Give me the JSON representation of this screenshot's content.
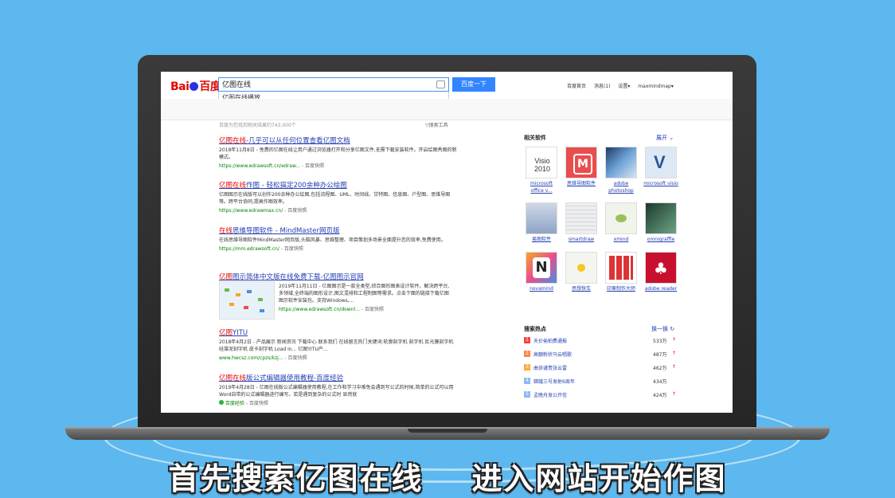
{
  "baidu": {
    "logo": "Bai百度",
    "search_query": "亿图在线",
    "search_button": "百度一下",
    "suggestion": "亿图在线播放",
    "suggest_feedback": "反馈",
    "user_links": [
      "百度首页",
      "消息(1)",
      "设置▾",
      "maxmindmap▾"
    ],
    "result_count": "百度为您找到相关结果约743,000个",
    "search_tools": "搜索工具"
  },
  "results": [
    {
      "title_pre": "",
      "title_em": "亿图在线",
      "title_post": "-几乎可以从任何位置查看亿图文档",
      "desc": "2018年11月8日 - 免费的亿图在线让用户通过浏览器打开和分享亿图文件,无需下载安装软件。开启绘图秀图的新模式。",
      "url": "https://www.edrawsoft.cn/edraw...",
      "cache": "- 百度快照"
    },
    {
      "title_pre": "",
      "title_em": "亿图在线",
      "title_post": "作图 - 轻松搞定200余种办公绘图",
      "desc": "亿图图示在线版可以创作200余种办公绘图,包括流程图、UML、时间线、甘特图、信息图、户型图、思维导图等。跨平台协同,提高作图效率。",
      "url": "https://www.edrawmax.cn/",
      "cache": "- 百度快照"
    },
    {
      "title_pre": "",
      "title_em": "在线",
      "title_post": "思维导图软件 - MindMaster网页版",
      "desc": "在线思维导图软件MindMaster网页版,头脑风暴、思维整理、项目策划多场景全面提升您的效率,免费使用。",
      "url": "https://mm.edrawsoft.cn/",
      "cache": "- 百度快照"
    },
    {
      "title_pre": "",
      "title_em": "亿图",
      "title_post": "图示简体中文版在线免费下载-亿图图示官网",
      "desc": "2019年11月11日 - 亿图图示是一款全类型,综合图形图表设计软件。解决跨平台,多领域,全终端的图形设计,图文混排和工程制图等需求。点击下面的链接下载亿图图示软件安装包。支持Windows,...",
      "url": "https://www.edrawsoft.cn/downl...",
      "cache": "- 百度快照"
    },
    {
      "title_pre": "",
      "title_em": "亿图",
      "title_post": "YITU",
      "desc": "2018年4月2日 - 产品展示 新闻资讯 下载中心 联系我们 在线留言热门关键词:轮廓刻字机 刻字机 反光膜刻字机 硅藻泥刻字机 皮卡刻字机 Load in... 亿图YITU产...",
      "url": "www.hwcsz.com/cpzs/kzj...",
      "cache": "- 百度快照"
    },
    {
      "title_pre": "",
      "title_em": "亿图在线",
      "title_post": "版公式编辑器使用教程-百度经验",
      "desc": "2019年4月28日 - 亿图在线版公式编辑器使用教程,在工作和学习中难免会遇到写公式的时候,简单的公式可以用Word自带的公式编辑器进行编写。若是遇到复杂的公式时 显然就",
      "url": "百度经验",
      "cache": "- 百度快照"
    }
  ],
  "sidebar": {
    "title": "相关软件",
    "more": "展开",
    "apps": [
      {
        "label": "microsoft office v...",
        "icon": "visio-2010-icon"
      },
      {
        "label": "思维导图软件",
        "icon": "mindmaster-icon"
      },
      {
        "label": "adobe photoshop",
        "icon": "photoshop-icon"
      },
      {
        "label": "microsoft visio",
        "icon": "visio-icon"
      },
      {
        "label": "易图软件",
        "icon": "yitu-icon"
      },
      {
        "label": "smartdraw",
        "icon": "smartdraw-icon"
      },
      {
        "label": "xmind",
        "icon": "xmind-icon"
      },
      {
        "label": "omnigraffle",
        "icon": "omnigraffle-icon"
      },
      {
        "label": "novamind",
        "icon": "novamind-icon"
      },
      {
        "label": "思想快车",
        "icon": "mindexpress-icon"
      },
      {
        "label": "印章制作大师",
        "icon": "seal-maker-icon"
      },
      {
        "label": "adobe reader",
        "icon": "adobe-reader-icon"
      }
    ],
    "hot_title": "搜索热点",
    "hot_refresh": "换一换",
    "hot": [
      {
        "num": "1",
        "text": "天价偷拍费通报",
        "count": "533万",
        "color": "#f54545"
      },
      {
        "num": "2",
        "text": "高额粉状马云唱歌",
        "count": "487万",
        "color": "#ff8547"
      },
      {
        "num": "3",
        "text": "曲协谴责张云雷",
        "count": "462万",
        "color": "#ffac38"
      },
      {
        "num": "4",
        "text": "嫦娥三号发射6周年",
        "count": "434万",
        "color": "#8eb9f5"
      },
      {
        "num": "5",
        "text": "孟晚舟发公开信",
        "count": "424万",
        "color": "#8eb9f5"
      }
    ]
  },
  "caption": "首先搜索亿图在线    进入网站开始作图"
}
